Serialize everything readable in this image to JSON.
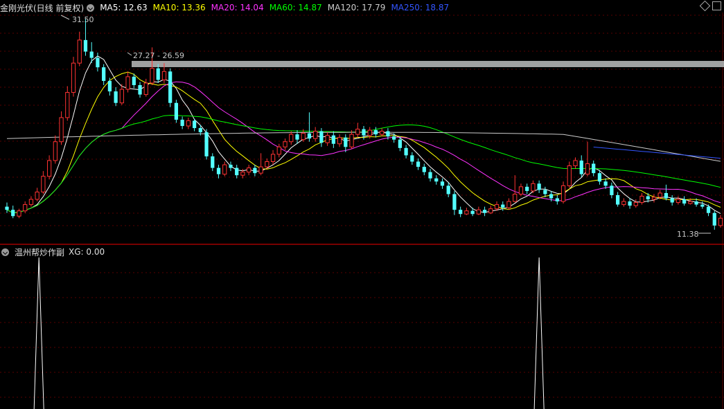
{
  "main_panel": {
    "stock_title": "金刚光伏(日线 前复权)",
    "ma_values": [
      {
        "label": "MA5: 12.63",
        "color": "#ffffff"
      },
      {
        "label": "MA10: 13.36",
        "color": "#ffff00"
      },
      {
        "label": "MA20: 14.04",
        "color": "#ff33ff"
      },
      {
        "label": "MA60: 14.87",
        "color": "#00ff00"
      },
      {
        "label": "MA120: 17.79",
        "color": "#cccccc"
      },
      {
        "label": "MA250: 18.87",
        "color": "#3355ff"
      }
    ],
    "high_label": "31.50",
    "range_label": "27.27 - 26.59",
    "low_label": "11.38"
  },
  "sub_panel": {
    "indicator_title": "温州帮炒作副",
    "xg_label": "XG: 0.00"
  },
  "colors": {
    "up": "#ff3333",
    "down": "#54ffff",
    "background": "#000000",
    "separator": "#8b0000",
    "band": "#a0a0a0"
  },
  "chart_data": {
    "type": "candlestick",
    "y_range": [
      11.0,
      32.0
    ],
    "candles": [
      [
        13.6,
        13.3,
        14.0,
        13.0
      ],
      [
        13.3,
        12.7,
        13.7,
        12.5
      ],
      [
        12.7,
        13.2,
        13.4,
        12.5
      ],
      [
        13.2,
        13.8,
        14.1,
        13.0
      ],
      [
        13.8,
        14.3,
        14.6,
        13.6
      ],
      [
        14.3,
        15.0,
        15.4,
        14.1
      ],
      [
        15.0,
        16.5,
        17.0,
        14.8
      ],
      [
        16.5,
        18.0,
        18.5,
        16.2
      ],
      [
        18.0,
        19.8,
        20.4,
        17.7
      ],
      [
        19.8,
        22.1,
        22.7,
        19.5
      ],
      [
        22.1,
        24.5,
        25.1,
        21.8
      ],
      [
        24.5,
        27.3,
        27.9,
        24.1
      ],
      [
        27.3,
        29.5,
        30.3,
        27.0
      ],
      [
        29.5,
        28.4,
        31.5,
        28.0
      ],
      [
        28.4,
        27.8,
        29.3,
        27.3
      ],
      [
        27.8,
        26.9,
        28.3,
        26.5
      ],
      [
        26.9,
        25.6,
        27.2,
        25.2
      ],
      [
        25.6,
        24.6,
        25.9,
        24.2
      ],
      [
        24.6,
        23.5,
        25.0,
        23.2
      ],
      [
        23.5,
        24.8,
        25.3,
        23.3
      ],
      [
        24.8,
        26.0,
        26.5,
        24.5
      ],
      [
        26.0,
        25.2,
        26.3,
        24.9
      ],
      [
        25.2,
        24.3,
        25.5,
        24.0
      ],
      [
        24.3,
        25.4,
        25.8,
        24.1
      ],
      [
        25.4,
        26.8,
        28.8,
        25.2
      ],
      [
        26.8,
        25.7,
        27.2,
        25.4
      ],
      [
        25.7,
        26.5,
        27.3,
        25.4
      ],
      [
        26.5,
        23.5,
        26.8,
        23.1
      ],
      [
        23.5,
        21.9,
        23.8,
        21.6
      ],
      [
        21.9,
        21.3,
        22.2,
        21.0
      ],
      [
        21.3,
        21.8,
        22.1,
        21.0
      ],
      [
        21.8,
        21.1,
        22.0,
        20.8
      ],
      [
        21.1,
        20.7,
        21.4,
        20.4
      ],
      [
        20.7,
        18.4,
        21.0,
        18.1
      ],
      [
        18.4,
        17.3,
        18.7,
        17.0
      ],
      [
        17.3,
        16.7,
        17.6,
        16.3
      ],
      [
        16.7,
        17.6,
        17.9,
        16.5
      ],
      [
        17.6,
        17.3,
        17.9,
        17.0
      ],
      [
        17.3,
        16.6,
        17.6,
        16.3
      ],
      [
        16.6,
        16.9,
        17.2,
        16.3
      ],
      [
        16.9,
        17.3,
        17.6,
        16.6
      ],
      [
        17.3,
        16.8,
        17.6,
        16.5
      ],
      [
        16.8,
        17.4,
        18.7,
        16.6
      ],
      [
        17.4,
        17.9,
        18.2,
        17.2
      ],
      [
        17.9,
        18.6,
        19.0,
        17.6
      ],
      [
        18.6,
        19.3,
        19.6,
        18.3
      ],
      [
        19.3,
        19.8,
        20.1,
        19.0
      ],
      [
        19.8,
        20.5,
        20.8,
        19.5
      ],
      [
        20.5,
        20.0,
        20.9,
        19.6
      ],
      [
        20.0,
        20.6,
        21.0,
        19.8
      ],
      [
        20.6,
        20.1,
        22.6,
        19.8
      ],
      [
        20.1,
        20.8,
        21.2,
        19.8
      ],
      [
        20.8,
        19.7,
        21.1,
        19.3
      ],
      [
        19.7,
        20.4,
        20.7,
        19.4
      ],
      [
        20.4,
        19.6,
        20.8,
        19.2
      ],
      [
        19.6,
        20.2,
        20.5,
        19.3
      ],
      [
        20.2,
        19.3,
        20.5,
        18.8
      ],
      [
        19.3,
        20.5,
        20.9,
        19.1
      ],
      [
        20.5,
        21.0,
        21.6,
        20.2
      ],
      [
        21.0,
        20.4,
        21.3,
        20.0
      ],
      [
        20.4,
        20.9,
        21.2,
        20.1
      ],
      [
        20.9,
        20.5,
        21.2,
        20.2
      ],
      [
        20.5,
        20.8,
        21.1,
        20.3
      ],
      [
        20.8,
        20.3,
        21.1,
        20.0
      ],
      [
        20.3,
        20.0,
        20.6,
        19.7
      ],
      [
        20.0,
        19.2,
        20.3,
        18.9
      ],
      [
        19.2,
        18.5,
        19.5,
        18.2
      ],
      [
        18.5,
        17.9,
        18.8,
        17.6
      ],
      [
        17.9,
        17.4,
        18.2,
        17.1
      ],
      [
        17.4,
        16.9,
        17.7,
        16.6
      ],
      [
        16.9,
        16.3,
        17.2,
        16.0
      ],
      [
        16.3,
        16.0,
        16.6,
        15.7
      ],
      [
        16.0,
        15.6,
        16.3,
        15.3
      ],
      [
        15.6,
        14.8,
        15.9,
        14.5
      ],
      [
        14.8,
        13.3,
        15.1,
        12.8
      ],
      [
        13.3,
        12.9,
        13.6,
        12.6
      ],
      [
        12.9,
        13.2,
        13.5,
        12.8
      ],
      [
        13.2,
        12.9,
        13.5,
        12.7
      ],
      [
        12.9,
        13.3,
        13.6,
        12.8
      ],
      [
        13.3,
        13.0,
        13.6,
        12.7
      ],
      [
        13.0,
        13.4,
        13.7,
        12.9
      ],
      [
        13.4,
        13.8,
        14.1,
        13.2
      ],
      [
        13.8,
        13.5,
        14.1,
        13.2
      ],
      [
        13.5,
        14.1,
        14.4,
        13.3
      ],
      [
        14.1,
        14.8,
        16.6,
        14.0
      ],
      [
        14.8,
        15.5,
        15.8,
        14.6
      ],
      [
        15.5,
        15.1,
        15.8,
        14.8
      ],
      [
        15.1,
        15.8,
        16.1,
        14.9
      ],
      [
        15.8,
        15.2,
        16.1,
        14.9
      ],
      [
        15.2,
        14.8,
        15.5,
        14.5
      ],
      [
        14.8,
        14.4,
        15.1,
        14.1
      ],
      [
        14.4,
        14.1,
        14.7,
        13.8
      ],
      [
        14.1,
        15.6,
        16.0,
        13.9
      ],
      [
        15.6,
        17.5,
        17.9,
        15.4
      ],
      [
        17.5,
        18.0,
        18.3,
        17.2
      ],
      [
        18.0,
        16.7,
        18.5,
        16.4
      ],
      [
        16.7,
        17.7,
        19.8,
        16.5
      ],
      [
        17.7,
        16.8,
        18.0,
        16.5
      ],
      [
        16.8,
        16.0,
        17.1,
        15.7
      ],
      [
        16.0,
        15.6,
        16.3,
        15.3
      ],
      [
        15.6,
        14.7,
        15.9,
        14.4
      ],
      [
        14.7,
        13.8,
        15.0,
        13.6
      ],
      [
        13.8,
        14.1,
        14.4,
        13.6
      ],
      [
        14.1,
        13.7,
        14.4,
        13.4
      ],
      [
        13.7,
        14.0,
        14.3,
        13.5
      ],
      [
        14.0,
        14.6,
        14.9,
        13.8
      ],
      [
        14.6,
        14.3,
        14.9,
        14.0
      ],
      [
        14.3,
        14.5,
        14.8,
        14.0
      ],
      [
        14.5,
        14.9,
        15.2,
        14.3
      ],
      [
        14.9,
        14.4,
        15.7,
        14.2
      ],
      [
        14.4,
        14.0,
        14.7,
        13.7
      ],
      [
        14.0,
        14.3,
        14.6,
        13.8
      ],
      [
        14.3,
        13.9,
        14.6,
        13.7
      ],
      [
        13.9,
        14.1,
        14.4,
        13.8
      ],
      [
        14.1,
        13.8,
        14.4,
        13.6
      ],
      [
        13.8,
        13.6,
        14.1,
        13.4
      ],
      [
        13.6,
        13.0,
        13.8,
        12.7
      ],
      [
        13.0,
        11.8,
        13.2,
        11.4
      ],
      [
        11.8,
        12.5,
        12.8,
        11.6
      ]
    ],
    "xg_signals": [
      3,
      88
    ]
  }
}
